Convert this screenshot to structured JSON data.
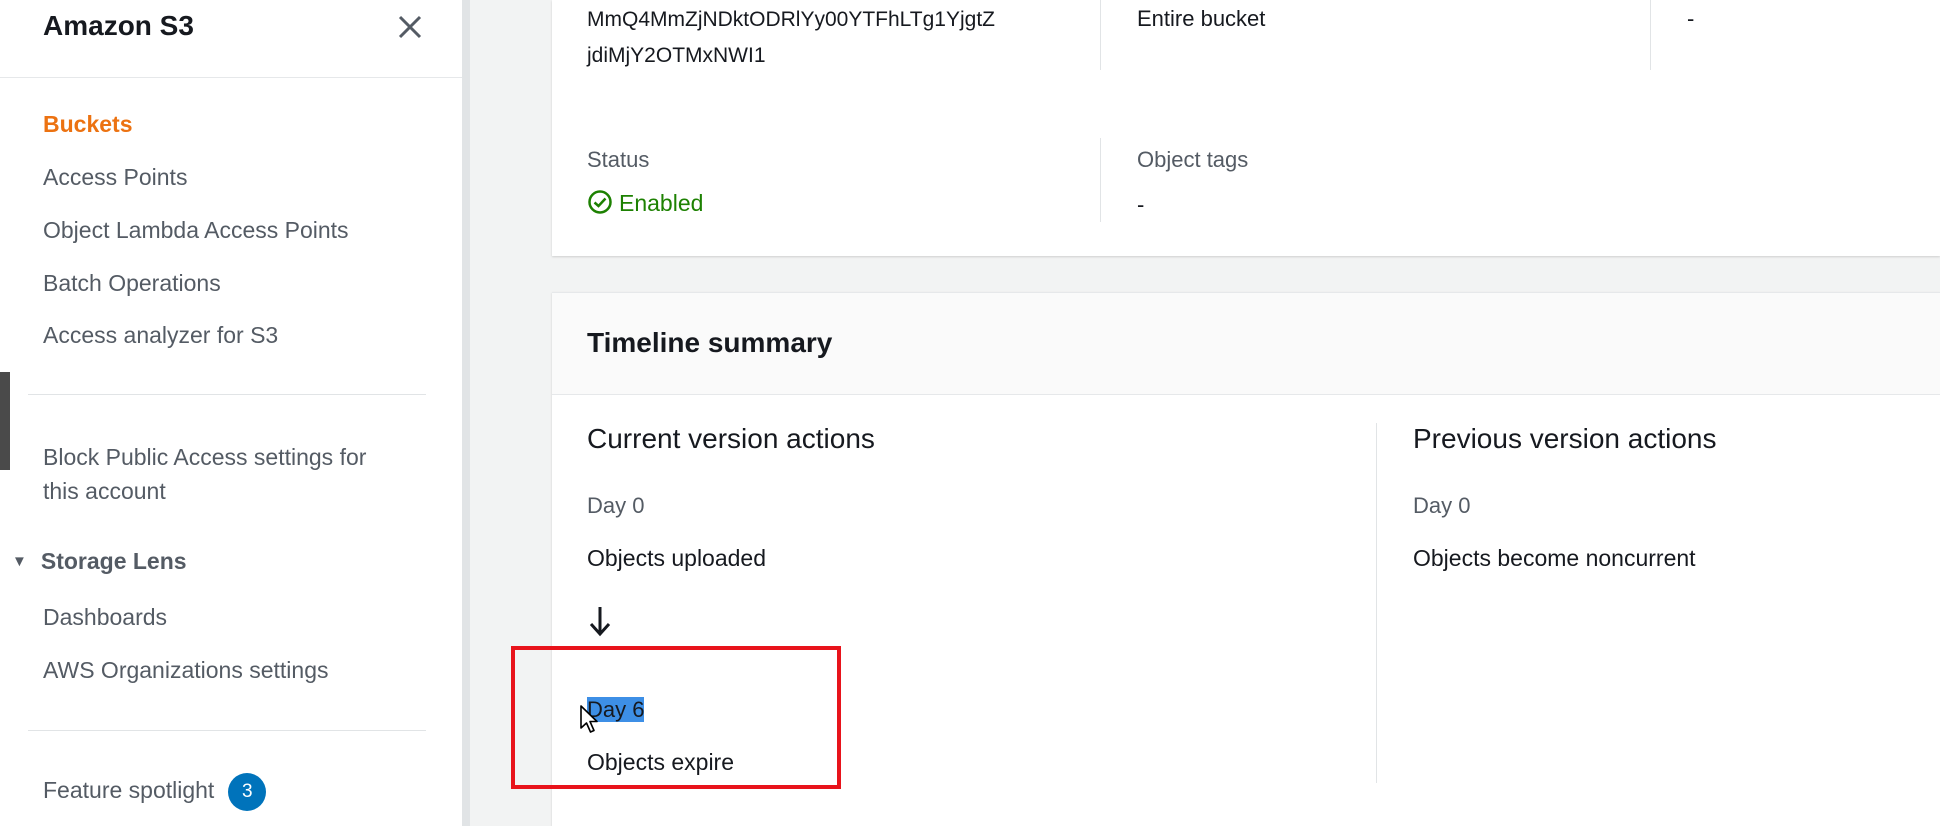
{
  "sidebar": {
    "title": "Amazon S3",
    "items": [
      {
        "label": "Buckets",
        "active": true
      },
      {
        "label": "Access Points"
      },
      {
        "label": "Object Lambda Access Points"
      },
      {
        "label": "Batch Operations"
      },
      {
        "label": "Access analyzer for S3"
      }
    ],
    "block_public_access": "Block Public Access settings for this account",
    "block_public_access_line1": "Block Public Access settings for",
    "block_public_access_line2": "this account",
    "storage_lens": {
      "label": "Storage Lens",
      "items": [
        {
          "label": "Dashboards"
        },
        {
          "label": "AWS Organizations settings"
        }
      ]
    },
    "feature_spotlight": {
      "label": "Feature spotlight",
      "count": "3"
    }
  },
  "rule": {
    "id_line1": "MmQ4MmZjNDktODRlYy00YTFhLTg1YjgtZ",
    "id_line2": "jdiMjY2OTMxNWI1",
    "scope": "Entire bucket",
    "third_value": "-",
    "status_label": "Status",
    "status_value": "Enabled",
    "object_tags_label": "Object tags",
    "object_tags_value": "-"
  },
  "timeline": {
    "title": "Timeline summary",
    "current": {
      "title": "Current version actions",
      "day0": "Day 0",
      "action0": "Objects uploaded",
      "day1": "Day 6",
      "action1": "Objects expire"
    },
    "previous": {
      "title": "Previous version actions",
      "day0": "Day 0",
      "action0": "Objects become noncurrent"
    }
  },
  "colors": {
    "accent": "#ec7211",
    "enabled": "#1d8102",
    "badge": "#0073bb",
    "selection": "#3d8fe6",
    "annotation": "#e8131b"
  },
  "icons": [
    "close-icon",
    "caret-down-icon",
    "check-circle-icon",
    "arrow-down-icon",
    "mouse-cursor-icon"
  ]
}
